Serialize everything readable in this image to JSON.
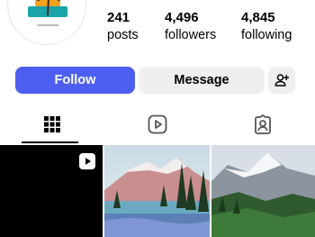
{
  "profile": {
    "avatar_icon": "palm-tree-logo"
  },
  "stats": {
    "posts_count": "241",
    "posts_label": "posts",
    "followers_count": "4,496",
    "followers_label": "followers",
    "following_count": "4,845",
    "following_label": "following"
  },
  "actions": {
    "follow_label": "Follow",
    "message_label": "Message",
    "add_user_icon": "add-user-icon"
  },
  "tabs": [
    {
      "icon": "grid-icon",
      "selected": true
    },
    {
      "icon": "reels-icon",
      "selected": false
    },
    {
      "icon": "tagged-icon",
      "selected": false
    }
  ],
  "posts": [
    {
      "type": "reel",
      "icon": "reel-play-icon"
    },
    {
      "type": "image"
    },
    {
      "type": "image"
    }
  ],
  "colors": {
    "accent": "#4c5ff0",
    "secondary_button": "#efefef"
  }
}
